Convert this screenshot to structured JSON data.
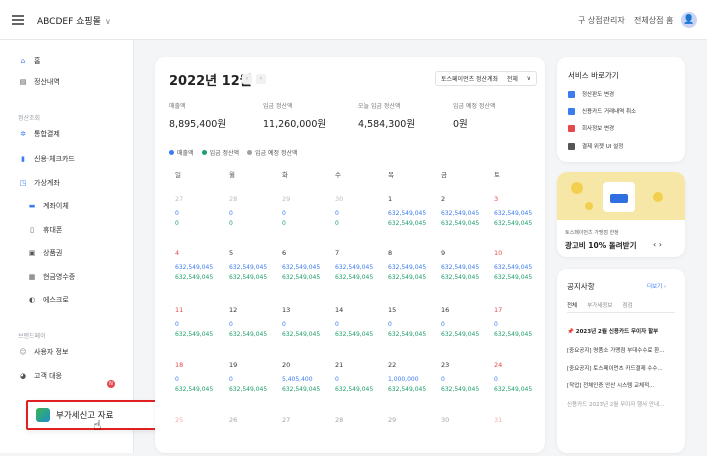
{
  "topbar": {
    "brand": "ABCDEF 쇼핑몰",
    "menu": [
      "구 상점관리자",
      "전체상점 홈"
    ],
    "avatar": "👤"
  },
  "sidebar": {
    "items": [
      {
        "label": "홈",
        "icon": "home-icon",
        "glyph": "⌂",
        "color": "#3b7cf0"
      },
      {
        "label": "정산내역",
        "icon": "ledger-icon",
        "glyph": "▤",
        "color": "#444"
      },
      {
        "label": "통합결제",
        "icon": "payment-icon",
        "glyph": "✲",
        "color": "#3b7cf0"
      },
      {
        "label": "신용·체크카드",
        "icon": "card-icon",
        "glyph": "▮",
        "color": "#3b7cf0"
      },
      {
        "label": "가상계좌",
        "icon": "virtual-account-icon",
        "glyph": "◳",
        "color": "#3b7cf0"
      },
      {
        "label": "계좌이체",
        "icon": "transfer-icon",
        "glyph": "▬",
        "color": "#3b7cf0"
      },
      {
        "label": "휴대폰",
        "icon": "phone-icon",
        "glyph": "▯",
        "color": "#555"
      },
      {
        "label": "상품권",
        "icon": "giftcard-icon",
        "glyph": "▣",
        "color": "#555"
      },
      {
        "label": "현금영수증",
        "icon": "receipt-icon",
        "glyph": "▦",
        "color": "#555"
      },
      {
        "label": "에스크로",
        "icon": "escrow-icon",
        "glyph": "◐",
        "color": "#555"
      },
      {
        "label": "사용자 정보",
        "icon": "user-icon",
        "glyph": "☺",
        "color": "#888"
      },
      {
        "label": "고객 대응",
        "icon": "support-icon",
        "glyph": "◕",
        "color": "#555"
      }
    ],
    "sections": [
      "정산조회",
      "브랜드페이"
    ],
    "highlight": "부가세신고 자료"
  },
  "main": {
    "title": "2022년 12월",
    "account_select": "토스페이먼츠 정산계좌",
    "account_value": "전체",
    "stats": [
      {
        "label": "매출액",
        "value": "8,895,400원"
      },
      {
        "label": "입금 정산액",
        "value": "11,260,000원"
      },
      {
        "label": "오늘 입금 정산액",
        "value": "4,584,300원"
      },
      {
        "label": "입금 예정 정산액",
        "value": "0원"
      }
    ],
    "legend": [
      {
        "label": "매출액",
        "color": "#3b7cf0"
      },
      {
        "label": "입금 정산액",
        "color": "#1e9e6a"
      },
      {
        "label": "입금 예정 정산액",
        "color": "#9aa0a6"
      }
    ],
    "weekdays": [
      "일",
      "월",
      "화",
      "수",
      "목",
      "금",
      "토"
    ],
    "weeks": [
      [
        {
          "d": "27",
          "a": "0",
          "b": "0",
          "prev": true
        },
        {
          "d": "28",
          "a": "0",
          "b": "0",
          "prev": true
        },
        {
          "d": "29",
          "a": "0",
          "b": "0",
          "prev": true
        },
        {
          "d": "30",
          "a": "0",
          "b": "0",
          "prev": true
        },
        {
          "d": "1",
          "a": "632,549,045",
          "b": "632,549,045"
        },
        {
          "d": "2",
          "a": "632,549,045",
          "b": "632,549,045"
        },
        {
          "d": "3",
          "a": "632,549,045",
          "b": "632,549,045"
        }
      ],
      [
        {
          "d": "4",
          "a": "632,549,045",
          "b": "632,549,045"
        },
        {
          "d": "5",
          "a": "632,549,045",
          "b": "632,549,045"
        },
        {
          "d": "6",
          "a": "632,549,045",
          "b": "632,549,045"
        },
        {
          "d": "7",
          "a": "632,549,045",
          "b": "632,549,045"
        },
        {
          "d": "8",
          "a": "632,549,045",
          "b": "632,549,045"
        },
        {
          "d": "9",
          "a": "632,549,045",
          "b": "632,549,045"
        },
        {
          "d": "10",
          "a": "632,549,045",
          "b": "632,549,045"
        }
      ],
      [
        {
          "d": "11",
          "a": "0",
          "b": "632,549,045"
        },
        {
          "d": "12",
          "a": "0",
          "b": "632,549,045"
        },
        {
          "d": "13",
          "a": "0",
          "b": "632,549,045"
        },
        {
          "d": "14",
          "a": "0",
          "b": "632,549,045"
        },
        {
          "d": "15",
          "a": "0",
          "b": "632,549,045"
        },
        {
          "d": "16",
          "a": "0",
          "b": "632,549,045"
        },
        {
          "d": "17",
          "a": "0",
          "b": "632,549,045"
        }
      ],
      [
        {
          "d": "18",
          "a": "0",
          "b": "632,549,045"
        },
        {
          "d": "19",
          "a": "0",
          "b": "632,549,045"
        },
        {
          "d": "20",
          "a": "5,405,400",
          "b": "632,549,045"
        },
        {
          "d": "21",
          "a": "0",
          "b": "632,549,045"
        },
        {
          "d": "22",
          "a": "1,000,000",
          "b": "632,549,045"
        },
        {
          "d": "23",
          "a": "0",
          "b": "632,549,045"
        },
        {
          "d": "24",
          "a": "0",
          "b": "632,549,045"
        }
      ],
      [
        {
          "d": "25",
          "a": "",
          "b": ""
        },
        {
          "d": "26",
          "a": "",
          "b": ""
        },
        {
          "d": "27",
          "a": "",
          "b": ""
        },
        {
          "d": "28",
          "a": "",
          "b": ""
        },
        {
          "d": "29",
          "a": "",
          "b": ""
        },
        {
          "d": "30",
          "a": "",
          "b": ""
        },
        {
          "d": "31",
          "a": "",
          "b": ""
        }
      ]
    ]
  },
  "service": {
    "title": "서비스 바로가기",
    "items": [
      {
        "label": "정산판도 변경",
        "color": "#3b7cf0"
      },
      {
        "label": "신용카드 거래내역 취소",
        "color": "#3b7cf0"
      },
      {
        "label": "회사정보 변경",
        "color": "#e5484d"
      },
      {
        "label": "결제 위젯 UI 설정",
        "color": "#555"
      }
    ]
  },
  "banner": {
    "subtitle": "토스페이먼츠 가맹점 한정",
    "title": "광고비 10% 돌려받기",
    "nav": "‹  ›"
  },
  "notice": {
    "title": "공지사항",
    "more": "더보기 ›",
    "tabs": [
      "전체",
      "부가세정보",
      "점검"
    ],
    "items": [
      {
        "text": "📌 2023년 2월 신용카드 무이자 할부",
        "style": "b"
      },
      {
        "text": "[중요공지] 명품소 가맹점 부대수수료 환...",
        "style": ""
      },
      {
        "text": "[중요공지] 토스페이먼츠 카드결제 수수...",
        "style": ""
      },
      {
        "text": "[작업] 전체인증 안산 시스템 교체적...",
        "style": ""
      },
      {
        "text": "신용카드 2023년 2월 무이자 행사 안내...",
        "style": "g"
      }
    ]
  }
}
